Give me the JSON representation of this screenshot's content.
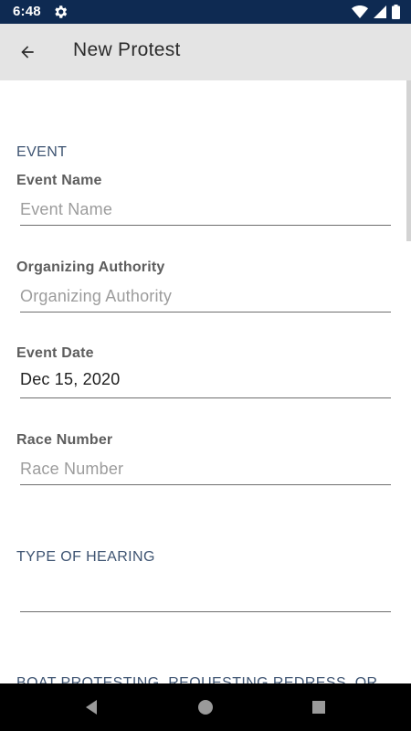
{
  "status_bar": {
    "time": "6:48",
    "icons": [
      "gear-icon",
      "wifi-icon",
      "signal-icon",
      "battery-icon"
    ]
  },
  "app_bar": {
    "title": "New Protest",
    "back_icon": "arrow-back-icon"
  },
  "form": {
    "event_section": "EVENT",
    "event_name": {
      "label": "Event Name",
      "placeholder": "Event Name",
      "value": ""
    },
    "organizing_authority": {
      "label": "Organizing Authority",
      "placeholder": "Organizing Authority",
      "value": ""
    },
    "event_date": {
      "label": "Event Date",
      "value": "Dec 15, 2020"
    },
    "race_number": {
      "label": "Race Number",
      "placeholder": "Race Number",
      "value": ""
    },
    "hearing_section": "TYPE OF HEARING",
    "hearing_value": "",
    "next_section_partial": "BOAT PROTESTING, REQUESTING REDRESS, OR"
  },
  "nav_bar": {
    "icons": [
      "back-triangle-icon",
      "home-circle-icon",
      "recents-square-icon"
    ]
  },
  "colors": {
    "status_bar": "#0e2a52",
    "app_bar": "#e4e4e4",
    "section_header": "#3e5472",
    "nav_bar": "#000000"
  }
}
